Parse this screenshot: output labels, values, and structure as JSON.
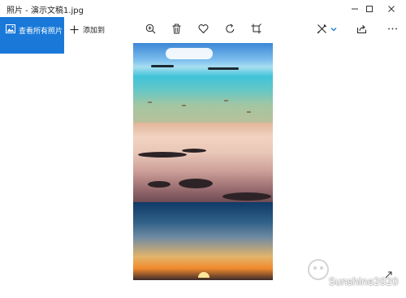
{
  "window": {
    "title": "照片 - 演示文稿1.jpg"
  },
  "toolbar": {
    "all_photos_label": "查看所有照片",
    "add_to_label": "添加到",
    "icons": [
      "zoom-icon",
      "delete-icon",
      "favorite-icon",
      "rotate-icon",
      "crop-icon",
      "edit-draw-icon",
      "share-icon",
      "more-icon"
    ]
  },
  "photo": {
    "panels": [
      "tropical-sea",
      "long-exposure-rocks",
      "sunset-sky"
    ]
  },
  "watermark": {
    "text": "Sunshine2020"
  },
  "colors": {
    "accent": "#1a79d8"
  }
}
